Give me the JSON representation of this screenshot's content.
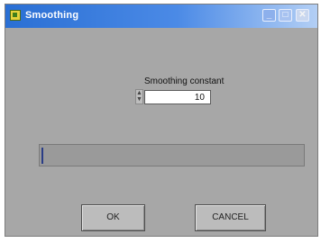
{
  "window": {
    "title": "Smoothing",
    "controls": {
      "minimize": "_",
      "maximize": "□",
      "close": "✕"
    },
    "icon": "labview-app-icon"
  },
  "form": {
    "label": "Smoothing constant",
    "value": "10",
    "spinner_icon": "updown-arrows-icon"
  },
  "progress": {
    "fraction": 0.01
  },
  "buttons": {
    "ok": "OK",
    "cancel": "CANCEL"
  },
  "colors": {
    "titlebar_start": "#2a6fd4",
    "titlebar_end": "#b3cff5",
    "panel": "#a7a7a7",
    "progress_fill": "#2a3d86"
  }
}
